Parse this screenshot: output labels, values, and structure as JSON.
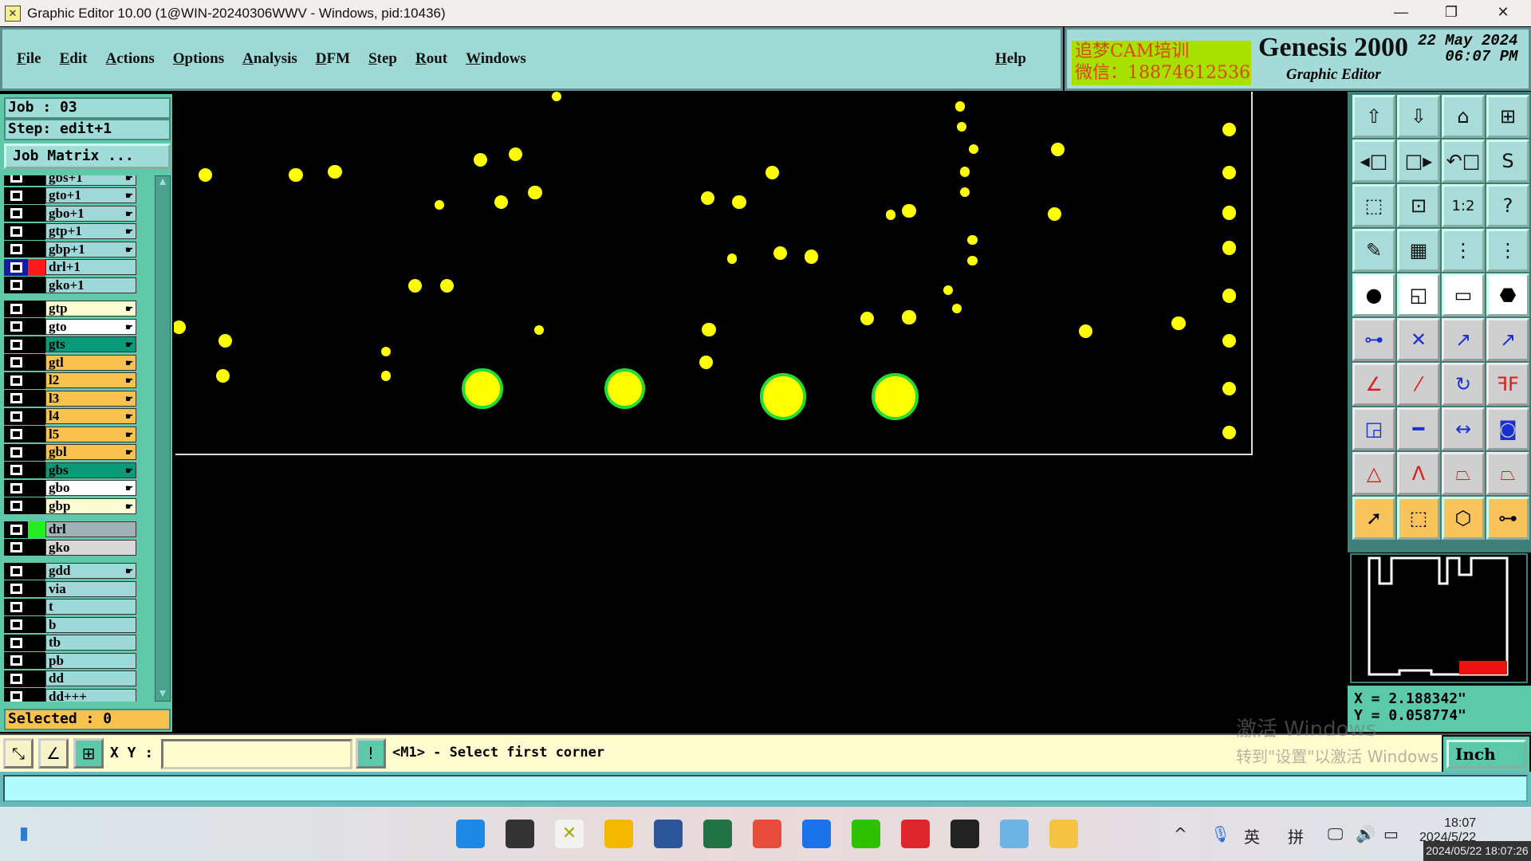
{
  "window": {
    "title": "Graphic Editor 10.00 (1@WIN-20240306WWV - Windows, pid:10436)",
    "controls": [
      "minimize",
      "restore",
      "close"
    ]
  },
  "menu": {
    "items": [
      "File",
      "Edit",
      "Actions",
      "Options",
      "Analysis",
      "DFM",
      "Step",
      "Rout",
      "Windows"
    ],
    "help": "Help"
  },
  "brand": {
    "promo_line1": "追梦CAM培训",
    "promo_line2": "微信：18874612536",
    "product": "Genesis 2000",
    "subtitle": "Graphic Editor",
    "date": "22 May 2024",
    "time": "06:07 PM"
  },
  "left": {
    "job": "Job : 03",
    "step": "Step: edit+1",
    "job_matrix": "Job Matrix ...",
    "selected": "Selected : 0",
    "layers": [
      {
        "name": "gbs+1",
        "bg": "#9ed8d8",
        "hand": true,
        "group": 0
      },
      {
        "name": "gto+1",
        "bg": "#9ed8d8",
        "hand": true,
        "group": 0
      },
      {
        "name": "gbo+1",
        "bg": "#9ed8d8",
        "hand": true,
        "group": 0
      },
      {
        "name": "gtp+1",
        "bg": "#9ed8d8",
        "hand": true,
        "group": 0
      },
      {
        "name": "gbp+1",
        "bg": "#9ed8d8",
        "hand": true,
        "group": 0
      },
      {
        "name": "drl+1",
        "bg": "#9ed8d8",
        "hand": false,
        "group": 0,
        "color": "#ff1a1a",
        "active": true
      },
      {
        "name": "gko+1",
        "bg": "#9ed8d8",
        "hand": false,
        "group": 0
      },
      {
        "name": "gtp",
        "bg": "#fffbd2",
        "hand": true,
        "group": 1
      },
      {
        "name": "gto",
        "bg": "#ffffff",
        "hand": true,
        "group": 1
      },
      {
        "name": "gts",
        "bg": "#0a9a78",
        "hand": true,
        "group": 1
      },
      {
        "name": "gtl",
        "bg": "#f9c24e",
        "hand": true,
        "group": 1
      },
      {
        "name": "l2",
        "bg": "#f9c24e",
        "hand": true,
        "group": 1
      },
      {
        "name": "l3",
        "bg": "#f9c24e",
        "hand": true,
        "group": 1
      },
      {
        "name": "l4",
        "bg": "#f9c24e",
        "hand": true,
        "group": 1
      },
      {
        "name": "l5",
        "bg": "#f9c24e",
        "hand": true,
        "group": 1
      },
      {
        "name": "gbl",
        "bg": "#f9c24e",
        "hand": true,
        "group": 1
      },
      {
        "name": "gbs",
        "bg": "#0a9a78",
        "hand": true,
        "group": 1
      },
      {
        "name": "gbo",
        "bg": "#ffffff",
        "hand": true,
        "group": 1
      },
      {
        "name": "gbp",
        "bg": "#fffbd2",
        "hand": true,
        "group": 1
      },
      {
        "name": "drl",
        "bg": "#9fb2b6",
        "hand": false,
        "group": 2,
        "color": "#22ee22"
      },
      {
        "name": "gko",
        "bg": "#d8d8d8",
        "hand": false,
        "group": 2
      },
      {
        "name": "gdd",
        "bg": "#9ed8d8",
        "hand": true,
        "group": 3
      },
      {
        "name": "via",
        "bg": "#9ed8d8",
        "hand": false,
        "group": 3
      },
      {
        "name": "t",
        "bg": "#9ed8d8",
        "hand": false,
        "group": 3
      },
      {
        "name": "b",
        "bg": "#9ed8d8",
        "hand": false,
        "group": 3
      },
      {
        "name": "tb",
        "bg": "#9ed8d8",
        "hand": false,
        "group": 3
      },
      {
        "name": "pb",
        "bg": "#9ed8d8",
        "hand": false,
        "group": 3
      },
      {
        "name": "dd",
        "bg": "#9ed8d8",
        "hand": false,
        "group": 3
      },
      {
        "name": "dd+++",
        "bg": "#9ed8d8",
        "hand": false,
        "group": 3
      }
    ]
  },
  "canvas": {
    "feature_color": "#ffff00",
    "highlight_color": "#22dd33"
  },
  "tools": [
    {
      "icon": "zoom-in-up-icon",
      "glyph": "⇧",
      "style": "teal"
    },
    {
      "icon": "zoom-out-down-icon",
      "glyph": "⇩",
      "style": "teal"
    },
    {
      "icon": "home-icon",
      "glyph": "⌂",
      "style": "teal"
    },
    {
      "icon": "xy-grid-icon",
      "glyph": "⊞",
      "style": "teal"
    },
    {
      "icon": "pan-left-icon",
      "glyph": "◂□",
      "style": "teal"
    },
    {
      "icon": "pan-right-icon",
      "glyph": "□▸",
      "style": "teal"
    },
    {
      "icon": "undo-view-icon",
      "glyph": "↶□",
      "style": "teal"
    },
    {
      "icon": "snake-icon",
      "glyph": "S",
      "style": "teal"
    },
    {
      "icon": "fit-all-icon",
      "glyph": "⬚",
      "style": "teal"
    },
    {
      "icon": "fit-center-icon",
      "glyph": "⊡",
      "style": "teal"
    },
    {
      "icon": "ratio-icon",
      "glyph": "1:2",
      "style": "teal"
    },
    {
      "icon": "help-icon",
      "glyph": "?",
      "style": "teal"
    },
    {
      "icon": "tools-palette-icon",
      "glyph": "✎",
      "style": "teal"
    },
    {
      "icon": "grid-icon",
      "glyph": "▦",
      "style": "teal"
    },
    {
      "icon": "netlist-icon",
      "glyph": "⋮",
      "style": "teal"
    },
    {
      "icon": "netlist-compare-icon",
      "glyph": "⋮",
      "style": "teal"
    },
    {
      "icon": "move-feature-icon",
      "glyph": "●",
      "style": "white"
    },
    {
      "icon": "copy-transform-icon",
      "glyph": "◱",
      "style": "white"
    },
    {
      "icon": "ruler-icon",
      "glyph": "▭",
      "style": "white"
    },
    {
      "icon": "pad-icon",
      "glyph": "⬣",
      "style": "white"
    },
    {
      "icon": "connect-icon",
      "glyph": "⊶",
      "style": "gray"
    },
    {
      "icon": "delete-icon",
      "glyph": "✕",
      "style": "gray"
    },
    {
      "icon": "move-point-icon",
      "glyph": "↗",
      "style": "gray"
    },
    {
      "icon": "move-pad-icon",
      "glyph": "↗",
      "style": "gray"
    },
    {
      "icon": "angle-line-icon",
      "glyph": "∠",
      "style": "gray"
    },
    {
      "icon": "line-edit-icon",
      "glyph": "⁄",
      "style": "gray"
    },
    {
      "icon": "rotate-icon",
      "glyph": "↻",
      "style": "gray"
    },
    {
      "icon": "mirror-icon",
      "glyph": "ꟻF",
      "style": "gray"
    },
    {
      "icon": "resize-pad-icon",
      "glyph": "◲",
      "style": "gray"
    },
    {
      "icon": "line-icon",
      "glyph": "━",
      "style": "gray"
    },
    {
      "icon": "stretch-icon",
      "glyph": "↔",
      "style": "gray"
    },
    {
      "icon": "surface-icon",
      "glyph": "◙",
      "style": "gray"
    },
    {
      "icon": "triangle-icon",
      "glyph": "△",
      "style": "gray"
    },
    {
      "icon": "arc-icon",
      "glyph": "Λ",
      "style": "gray"
    },
    {
      "icon": "trapezoid-icon",
      "glyph": "⏢",
      "style": "gray"
    },
    {
      "icon": "trapezoid-cross-icon",
      "glyph": "⏢",
      "style": "gray"
    },
    {
      "icon": "select-arrow-icon",
      "glyph": "➚",
      "style": "or"
    },
    {
      "icon": "select-box-icon",
      "glyph": "⬚",
      "style": "or"
    },
    {
      "icon": "select-polygon-icon",
      "glyph": "⬡",
      "style": "or"
    },
    {
      "icon": "select-net-icon",
      "glyph": "⊶",
      "style": "or"
    }
  ],
  "coords": {
    "x": "X = 2.188342\"",
    "y": "Y = 0.058774\""
  },
  "bottom": {
    "xy_label": "X Y :",
    "xy_value": "",
    "message": "<M1> - Select first corner",
    "unit": "Inch"
  },
  "watermark": {
    "line1": "激活 Windows",
    "line2": "转到\"设置\"以激活 Windows"
  },
  "taskbar": {
    "apps": [
      "start",
      "terminal",
      "graphic-editor",
      "file-explorer",
      "word",
      "excel",
      "app-store",
      "photos",
      "wechat",
      "opera",
      "app-red",
      "app-cloud",
      "app-butterfly"
    ],
    "tray": {
      "ime1": "英",
      "ime2": "拼"
    },
    "time": "18:07",
    "date": "2024/5/22",
    "stamp": "2024/05/22 18:07:26"
  }
}
